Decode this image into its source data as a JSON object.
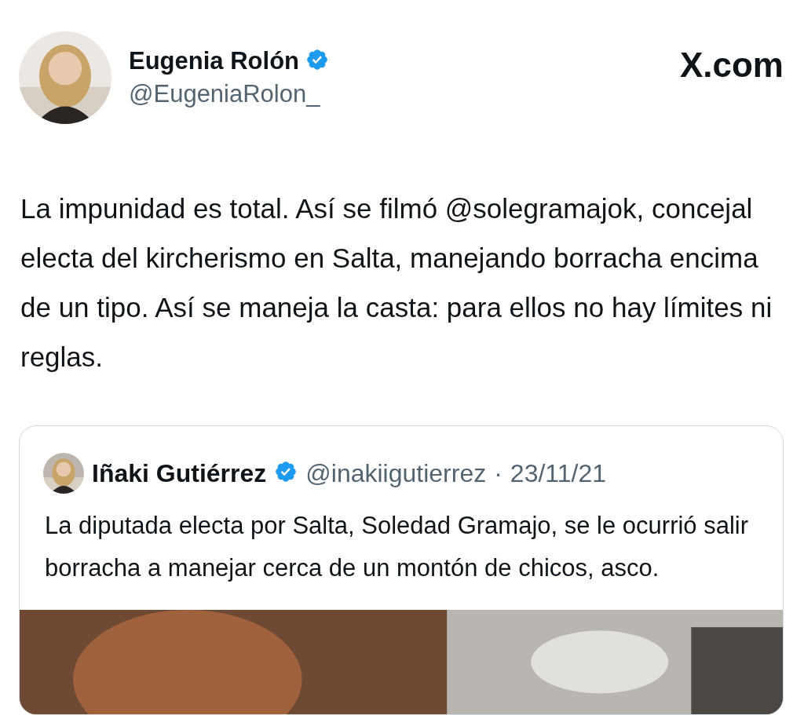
{
  "author": {
    "name": "Eugenia Rolón",
    "verified": true,
    "handle": "@EugeniaRolon_"
  },
  "site_logo": "X.com",
  "tweet_text": "La impunidad es total. Así se filmó @solegramajok, concejal electa del kircherismo en Salta, manejando borracha encima de un tipo. Así se maneja la casta: para ellos no hay límites ni reglas.",
  "quoted_tweet": {
    "name": "Iñaki Gutiérrez",
    "verified": true,
    "handle": "@inakiigutierrez",
    "separator": "·",
    "date": "23/11/21",
    "text": "La diputada electa por Salta, Soledad Gramajo, se le ocurrió salir borracha a manejar cerca de un montón de chicos, asco."
  }
}
